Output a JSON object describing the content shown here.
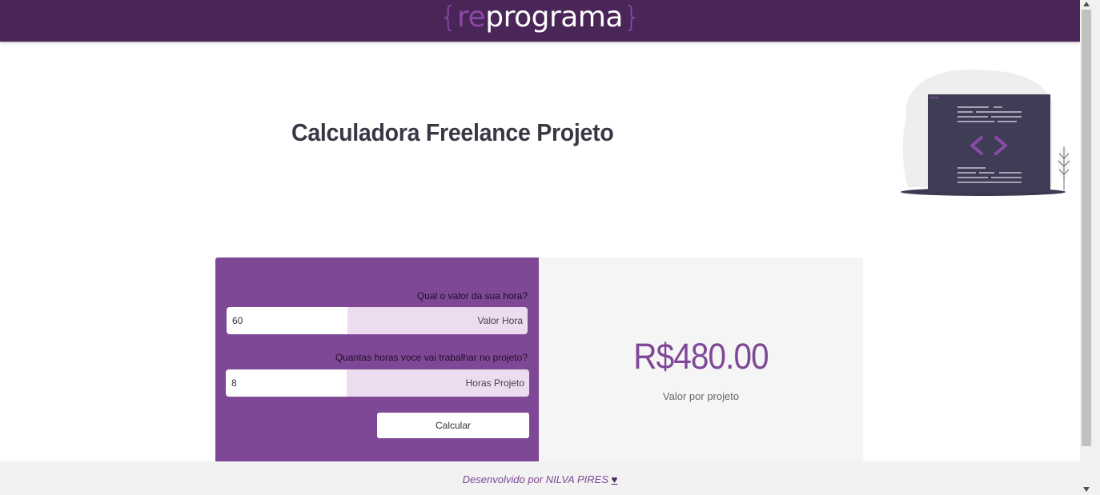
{
  "header": {
    "logo_open_brace": "{",
    "logo_re": "re",
    "logo_rest": "programa",
    "logo_close_brace": "}"
  },
  "page": {
    "title": "Calculadora Freelance Projeto"
  },
  "form": {
    "hour_question": "Qual o valor da sua hora?",
    "hour_value": "60",
    "hour_addon": "Valor Hora",
    "hours_question": "Quantas horas voce vai trabalhar no projeto?",
    "hours_value": "8",
    "hours_addon": "Horas Projeto",
    "calculate_label": "Calcular"
  },
  "result": {
    "value": "R$480.00",
    "caption": "Valor por projeto"
  },
  "footer": {
    "text": "Desenvolvido por NILVA PIRES",
    "heart": "♥"
  },
  "colors": {
    "header_bg": "#4a2557",
    "accent_purple": "#7f4897",
    "addon_bg": "#eddcf0",
    "result_bg": "#f5f5f5"
  },
  "icons": [
    "code-window-illustration",
    "plant-illustration",
    "scroll-up-arrow-icon",
    "scroll-down-arrow-icon"
  ]
}
